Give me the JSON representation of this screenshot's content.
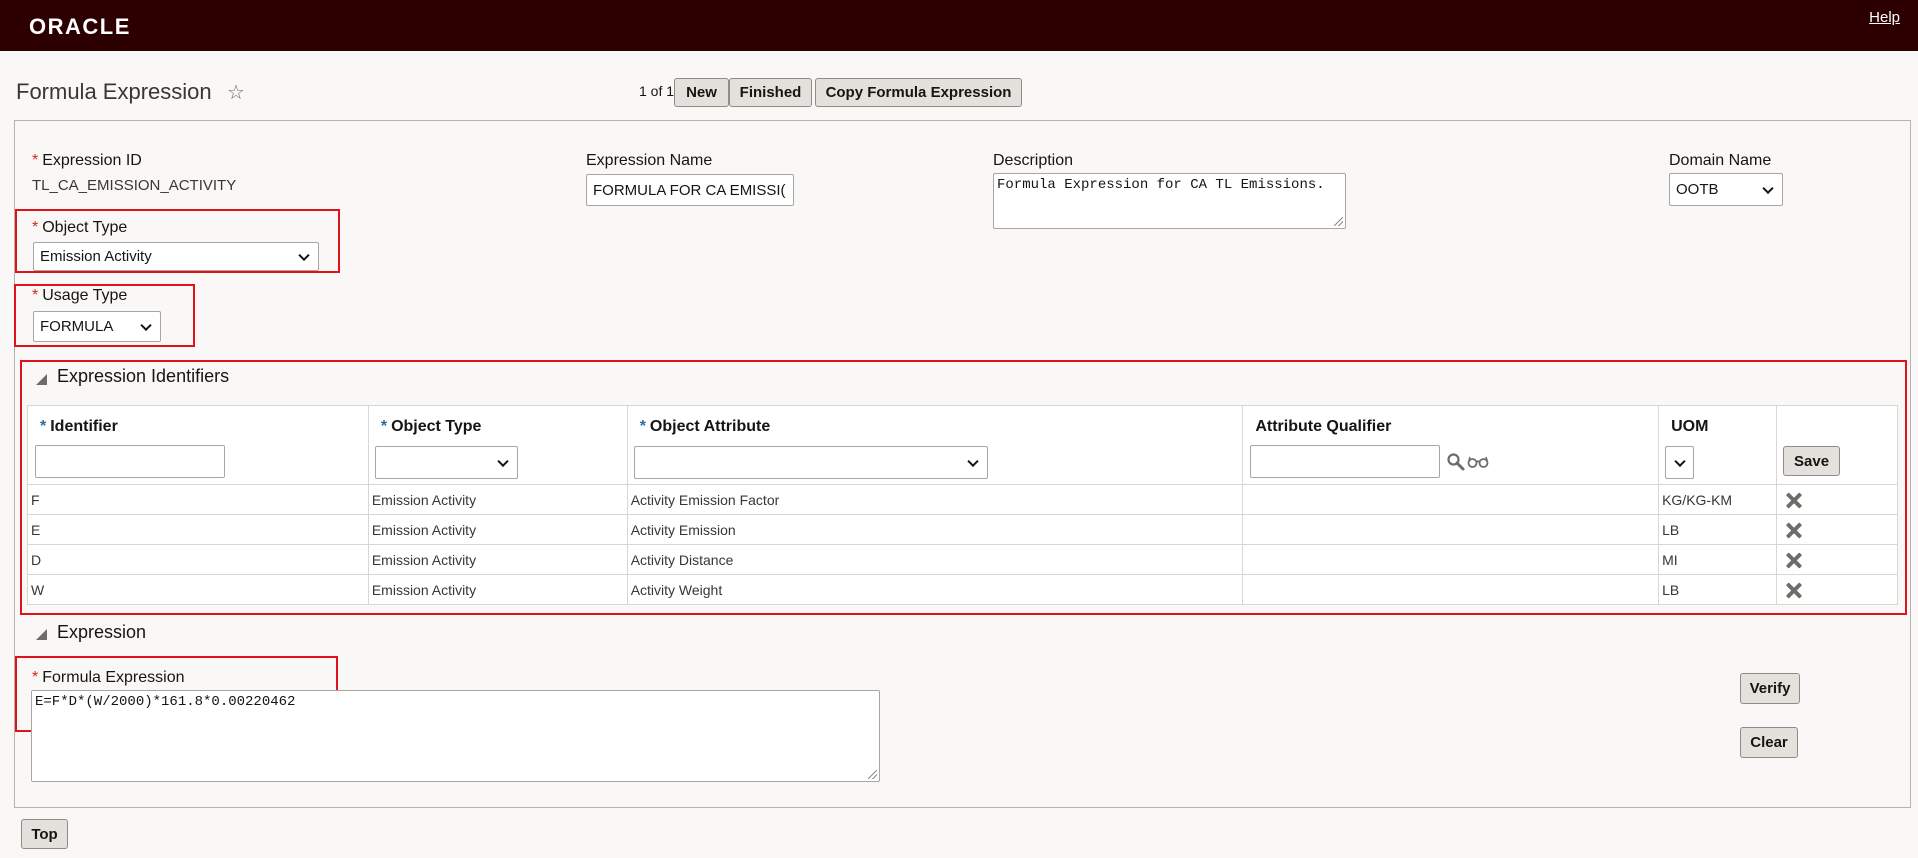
{
  "header": {
    "brand": "ORACLE",
    "help_label": "Help"
  },
  "page": {
    "title": "Formula Expression",
    "pager": "1 of 1",
    "buttons": {
      "new": "New",
      "finished": "Finished",
      "copy": "Copy Formula Expression"
    }
  },
  "form": {
    "expression_id": {
      "label": "Expression ID",
      "value": "TL_CA_EMISSION_ACTIVITY"
    },
    "expression_name": {
      "label": "Expression Name",
      "value": "FORMULA FOR CA EMISSI("
    },
    "description": {
      "label": "Description",
      "value": "Formula Expression for CA TL Emissions."
    },
    "domain_name": {
      "label": "Domain Name",
      "value": "OOTB"
    },
    "object_type": {
      "label": "Object Type",
      "value": "Emission Activity"
    },
    "usage_type": {
      "label": "Usage Type",
      "value": "FORMULA"
    }
  },
  "identifiers": {
    "section_title": "Expression Identifiers",
    "columns": {
      "identifier": "Identifier",
      "object_type": "Object Type",
      "object_attribute": "Object Attribute",
      "attribute_qualifier": "Attribute Qualifier",
      "uom": "UOM"
    },
    "save_label": "Save",
    "rows": [
      {
        "identifier": "F",
        "object_type": "Emission Activity",
        "object_attribute": "Activity Emission Factor",
        "attribute_qualifier": "",
        "uom": "KG/KG-KM"
      },
      {
        "identifier": "E",
        "object_type": "Emission Activity",
        "object_attribute": "Activity Emission",
        "attribute_qualifier": "",
        "uom": "LB"
      },
      {
        "identifier": "D",
        "object_type": "Emission Activity",
        "object_attribute": "Activity Distance",
        "attribute_qualifier": "",
        "uom": "MI"
      },
      {
        "identifier": "W",
        "object_type": "Emission Activity",
        "object_attribute": "Activity Weight",
        "attribute_qualifier": "",
        "uom": "LB"
      }
    ]
  },
  "expression": {
    "section_title": "Expression",
    "formula_label": "Formula Expression",
    "formula_value": "E=F*D*(W/2000)*161.8*0.00220462",
    "verify_label": "Verify",
    "clear_label": "Clear"
  },
  "footer": {
    "top_label": "Top"
  },
  "colors": {
    "header_bg": "#2c0000",
    "required": "#d3271f",
    "highlight": "#e0131d"
  }
}
